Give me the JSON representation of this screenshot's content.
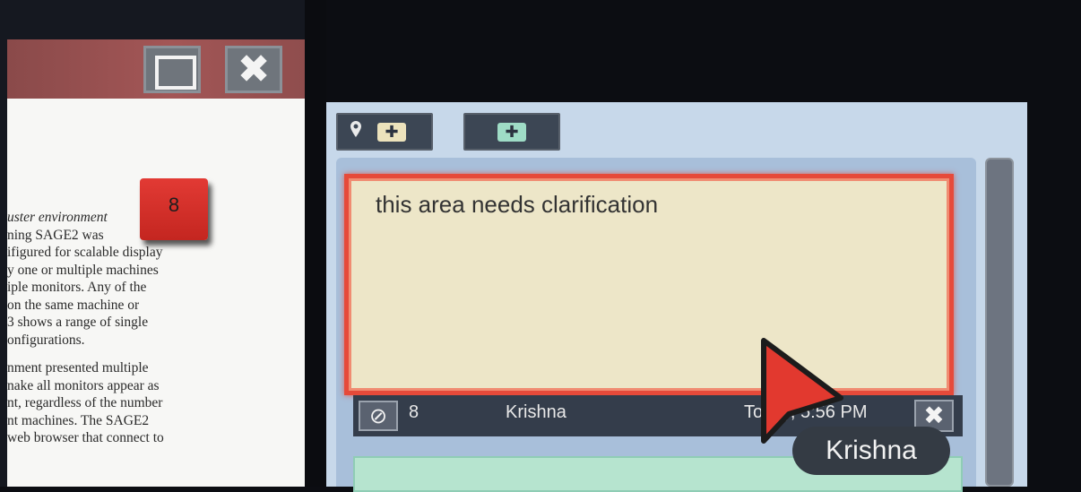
{
  "pdf_window": {
    "badge_number": "8",
    "lines": [
      {
        "text": "uster environment",
        "italic": true
      },
      {
        "text": "ning SAGE2 was",
        "italic": false
      },
      {
        "text": "ifigured for scalable display",
        "italic": false
      },
      {
        "text": "y one or multiple machines",
        "italic": false
      },
      {
        "text": "iple monitors. Any of the",
        "italic": false
      },
      {
        "text": "on the same machine or",
        "italic": false
      },
      {
        "text": "3 shows a range of single",
        "italic": false
      },
      {
        "text": "onfigurations.",
        "italic": false
      },
      {
        "text": "",
        "italic": false
      },
      {
        "text": "nment presented multiple",
        "italic": false
      },
      {
        "text": "nake all monitors appear as",
        "italic": false
      },
      {
        "text": "nt, regardless of the number",
        "italic": false
      },
      {
        "text": "nt machines. The SAGE2",
        "italic": false
      },
      {
        "text": "web browser that connect to",
        "italic": false
      }
    ],
    "buttons": {
      "maximize": "maximize-window",
      "close_glyph": "✖"
    }
  },
  "notes_app": {
    "toolbar": {
      "add_pinned_icon": "map-pin-icon",
      "add_glyph": "✚"
    },
    "note": {
      "text": "this area needs clarification",
      "page_number": "8",
      "author": "Krishna",
      "timestamp": "Today, 5:56 PM",
      "close_glyph": "✖",
      "pin_glyph": "⊘"
    }
  },
  "pointer": {
    "label": "Krishna",
    "color": "#e2392f"
  },
  "colors": {
    "note_border": "#e64a3a",
    "note_bg": "#ede6c8",
    "panel_bg": "#c7d8ea",
    "title_bar": "#a35656",
    "badge": "#e23a34"
  }
}
